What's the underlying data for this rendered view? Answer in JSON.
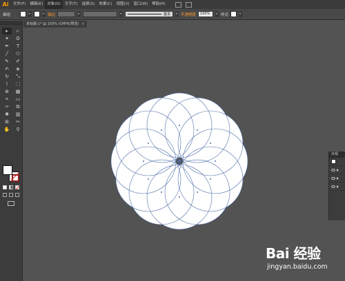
{
  "app": {
    "logo": "Ai"
  },
  "menu": {
    "items": [
      {
        "label": "文件(F)"
      },
      {
        "label": "编辑(E)"
      },
      {
        "label": "对象(O)"
      },
      {
        "label": "文字(T)"
      },
      {
        "label": "选择(S)"
      },
      {
        "label": "效果(C)"
      },
      {
        "label": "视图(V)"
      },
      {
        "label": "窗口(W)"
      },
      {
        "label": "帮助(H)"
      }
    ],
    "active_index": 2
  },
  "controlbar": {
    "group_label": "编组",
    "stroke_label": "描边",
    "stroke_style": "基本",
    "opacity_label": "不透明度",
    "opacity_value": "100%",
    "style_label": "样式"
  },
  "document": {
    "tab_title": "未标题-1* @ 150% (CMYK/预览)",
    "close_symbol": "×"
  },
  "tools": [
    "select-tool",
    "direct-select-tool",
    "magic-wand-tool",
    "lasso-tool",
    "pen-tool",
    "type-tool",
    "line-tool",
    "ellipse-tool",
    "paintbrush-tool",
    "pencil-tool",
    "blob-brush-tool",
    "eraser-tool",
    "rotate-tool",
    "scale-tool",
    "width-tool",
    "free-transform-tool",
    "shape-builder-tool",
    "perspective-grid-tool",
    "mesh-tool",
    "gradient-tool",
    "eyedropper-tool",
    "blend-tool",
    "symbol-sprayer-tool",
    "column-graph-tool",
    "artboard-tool",
    "slice-tool",
    "hand-tool",
    "zoom-tool"
  ],
  "tool_glyphs": [
    "▸",
    "▹",
    "✦",
    "ʘ",
    "✒",
    "T",
    "╱",
    "⬭",
    "✎",
    "✐",
    "✍",
    "◈",
    "↻",
    "⤡",
    "⌇",
    "⬚",
    "⊕",
    "▦",
    "⌗",
    "▭",
    "✑",
    "⧉",
    "✺",
    "▥",
    "⊞",
    "✂",
    "✋",
    "⚲"
  ],
  "right_panel": {
    "title": "外观"
  },
  "watermark": {
    "logo": "Bai 经验",
    "url": "jingyan.baidu.com"
  },
  "colors": {
    "accent_orange": "#ff9a2e",
    "petal_fill": "#ffffff",
    "petal_stroke": "#4f6fa8",
    "canvas_bg": "#535353"
  }
}
